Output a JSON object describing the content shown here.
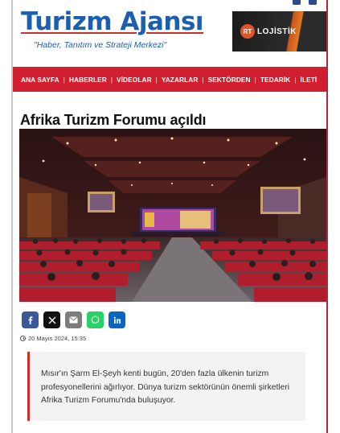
{
  "site": {
    "name": "Turizm Ajansı",
    "tagline": "\"Haber, Tanıtım ve Strateji Merkezi\""
  },
  "ad": {
    "badge": "RT",
    "text": "LOJİSTİK"
  },
  "nav": {
    "items": [
      "ANA SAYFA",
      "HABERLER",
      "VİDEOLAR",
      "YAZARLAR",
      "SEKTÖRDEN",
      "TEDARİK",
      "İLETİ"
    ],
    "separator": "|"
  },
  "article": {
    "title": "Afrika Turizm Forumu açıldı",
    "date": "20 Mayıs 2024, 15:35",
    "summary": "Mısır'ın Şarm El-Şeyh kenti bugün, 20'den fazla ülkenin turizm profesyonellerini ağırlıyor. Dünya turizm sektörünün önemli şirketleri Afrika Turizm Forumu'nda buluşuyor."
  },
  "share": [
    {
      "name": "facebook",
      "icon": "facebook-icon",
      "color": "#3b5998"
    },
    {
      "name": "x",
      "icon": "x-icon",
      "color": "#111111"
    },
    {
      "name": "email",
      "icon": "email-icon",
      "color": "#7d7d7d"
    },
    {
      "name": "whatsapp",
      "icon": "whatsapp-icon",
      "color": "#25d366"
    },
    {
      "name": "linkedin",
      "icon": "linkedin-icon",
      "color": "#0a66c2"
    }
  ],
  "colors": {
    "brand_blue": "#1d5fad",
    "nav_red": "#d11f2f",
    "quote_border": "#c9302c"
  }
}
